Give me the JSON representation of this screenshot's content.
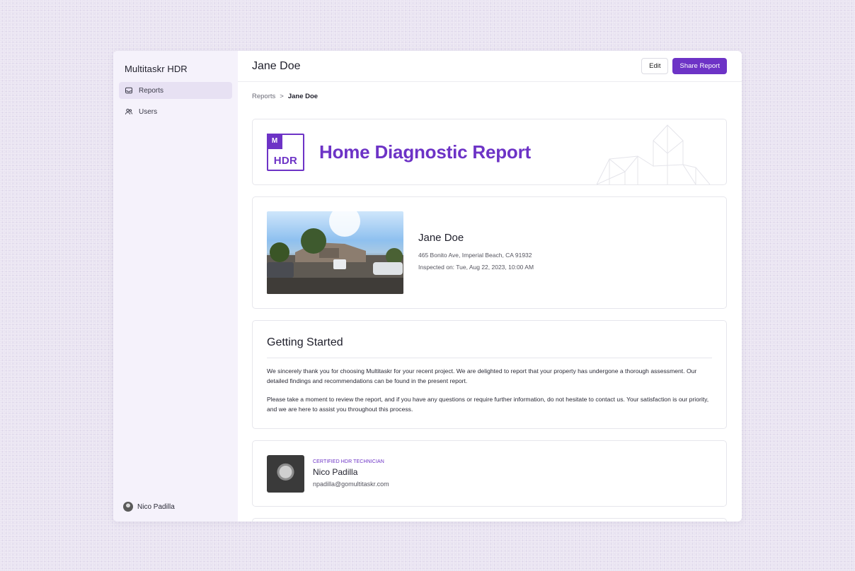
{
  "app": {
    "title": "Multitaskr HDR"
  },
  "sidebar": {
    "items": [
      {
        "label": "Reports",
        "icon": "inbox-icon",
        "active": true
      },
      {
        "label": "Users",
        "icon": "users-icon",
        "active": false
      }
    ],
    "user": {
      "name": "Nico Padilla"
    }
  },
  "header": {
    "title": "Jane Doe",
    "edit_label": "Edit",
    "share_label": "Share Report"
  },
  "breadcrumb": {
    "parent": "Reports",
    "separator": ">",
    "current": "Jane Doe"
  },
  "banner": {
    "logo_mark": "M",
    "logo_text": "HDR",
    "title": "Home Diagnostic Report"
  },
  "property": {
    "name": "Jane Doe",
    "address": "465 Bonito Ave, Imperial Beach, CA 91932",
    "inspected": "Inspected on: Tue, Aug 22, 2023, 10:00 AM"
  },
  "getting_started": {
    "title": "Getting Started",
    "paragraphs": [
      "We sincerely thank you for choosing Multitaskr for your recent project. We are delighted to report that your property has undergone a thorough assessment. Our detailed findings and recommendations can be found in the present report.",
      "Please take a moment to review the report, and if you have any questions or require further information, do not hesitate to contact us. Your satisfaction is our priority, and we are here to assist you throughout this process."
    ]
  },
  "technician": {
    "role": "CERTIFIED HDR TECHNICIAN",
    "name": "Nico Padilla",
    "email": "npadilla@gomultitaskr.com"
  },
  "colors": {
    "accent": "#6d33c6",
    "sidebar_bg": "#f5f2fb",
    "active_item": "#e7e1f3"
  }
}
